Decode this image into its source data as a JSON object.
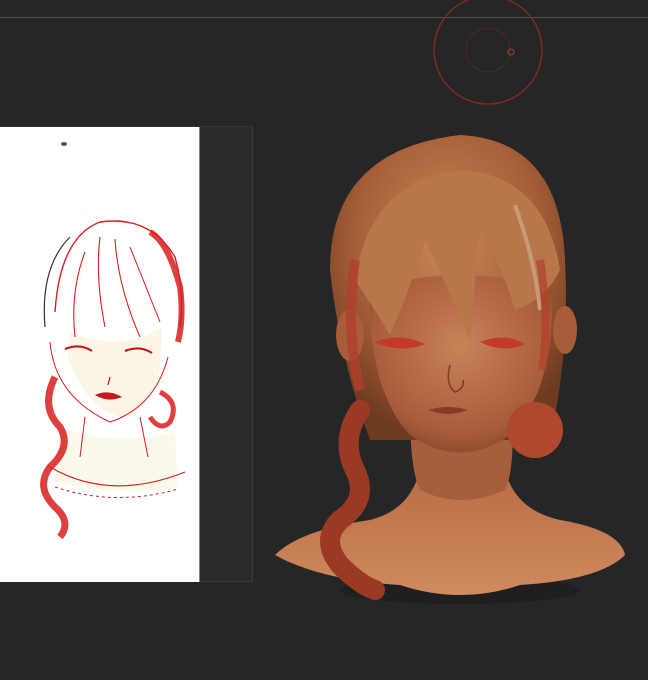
{
  "app": {
    "background_color": "#262626",
    "divider_color": "#505050"
  },
  "brush_cursor": {
    "icon": "brush-radius-cursor-icon",
    "color": "#8a2a22"
  },
  "reference_panel": {
    "icon": "reference-sketch-image",
    "paper_color": "#ffffff",
    "line_color": "#d81e1e"
  },
  "viewport": {
    "icon": "sculpt-bust-model",
    "skin_color": "#b46b45",
    "hair_color": "#a85a36",
    "accent_color": "#c0402a"
  }
}
